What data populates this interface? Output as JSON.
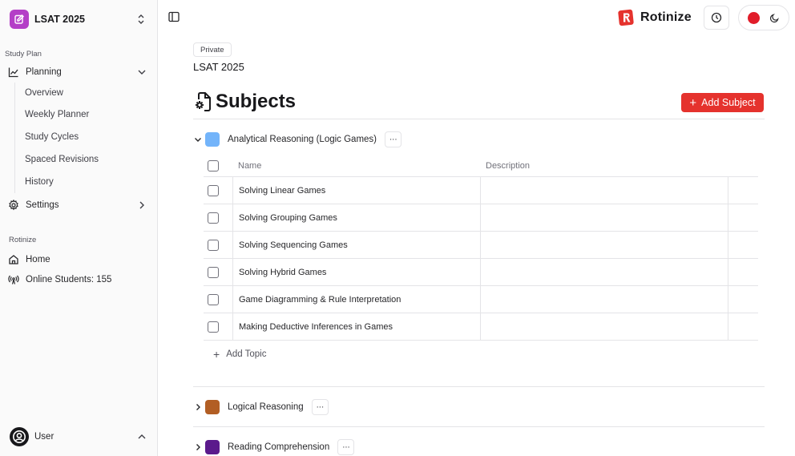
{
  "workspace": {
    "name": "LSAT 2025",
    "color": "#b43fc7"
  },
  "sidebar": {
    "study_plan_label": "Study Plan",
    "planning": {
      "label": "Planning",
      "items": [
        "Overview",
        "Weekly Planner",
        "Study Cycles",
        "Spaced Revisions",
        "History"
      ]
    },
    "settings_label": "Settings",
    "rotinize_label": "Rotinize",
    "home_label": "Home",
    "online_students_label": "Online Students: 155",
    "user_name": "User"
  },
  "header": {
    "brand_name": "Rotinize",
    "brand_color": "#e5322d"
  },
  "main": {
    "visibility": "Private",
    "plan_title": "LSAT 2025",
    "section_title": "Subjects",
    "add_subject_label": "Add Subject",
    "accent_color": "#e5322d",
    "subjects": [
      {
        "name": "Analytical Reasoning (Logic Games)",
        "color": "#73b4fa",
        "expanded": true,
        "columns": {
          "name": "Name",
          "description": "Description"
        },
        "topics": [
          {
            "name": "Solving Linear Games",
            "description": ""
          },
          {
            "name": "Solving Grouping Games",
            "description": ""
          },
          {
            "name": "Solving Sequencing Games",
            "description": ""
          },
          {
            "name": "Solving Hybrid Games",
            "description": ""
          },
          {
            "name": "Game Diagramming & Rule Interpretation",
            "description": ""
          },
          {
            "name": "Making Deductive Inferences in Games",
            "description": ""
          }
        ],
        "add_topic_label": "Add Topic"
      },
      {
        "name": "Logical Reasoning",
        "color": "#b25e24",
        "expanded": false
      },
      {
        "name": "Reading Comprehension",
        "color": "#5b1a8c",
        "expanded": false
      }
    ],
    "more_glyph": "···"
  }
}
